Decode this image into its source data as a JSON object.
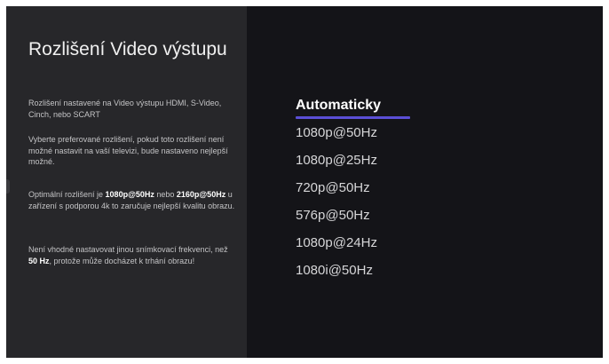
{
  "settings_panel": {
    "title": "Rozlišení Video výstupu",
    "description_1": "Rozlišení nastavené na Video výstupu HDMI, S-Video, Cinch, nebo SCART",
    "description_2": "Vyberte preferované rozlišení, pokud toto rozlišení není možné nastavit na vaší televizi, bude nastaveno nejlepší možné.",
    "description_3": {
      "part_1": "Optimální rozlišení je ",
      "bold_1": "1080p@50Hz",
      "part_2": " nebo ",
      "bold_2": "2160p@50Hz",
      "part_3": " u zařízení s podporou 4k to zaručuje nejlepší kvalitu obrazu."
    },
    "description_4": {
      "part_1": "Není vhodné nastavovat jinou snímkovací frekvenci, než ",
      "bold_1": "50 Hz",
      "part_2": ", protože může docházet k trhání obrazu!"
    }
  },
  "resolution_options": {
    "selected_index": 0,
    "items": [
      {
        "label": "Automaticky"
      },
      {
        "label": "1080p@50Hz"
      },
      {
        "label": "1080p@25Hz"
      },
      {
        "label": "720p@50Hz"
      },
      {
        "label": "576p@50Hz"
      },
      {
        "label": "1080p@24Hz"
      },
      {
        "label": "1080i@50Hz"
      }
    ]
  },
  "colors": {
    "accent_underline": "#5b4fd6",
    "background": "#141418",
    "panel": "#27272a"
  }
}
